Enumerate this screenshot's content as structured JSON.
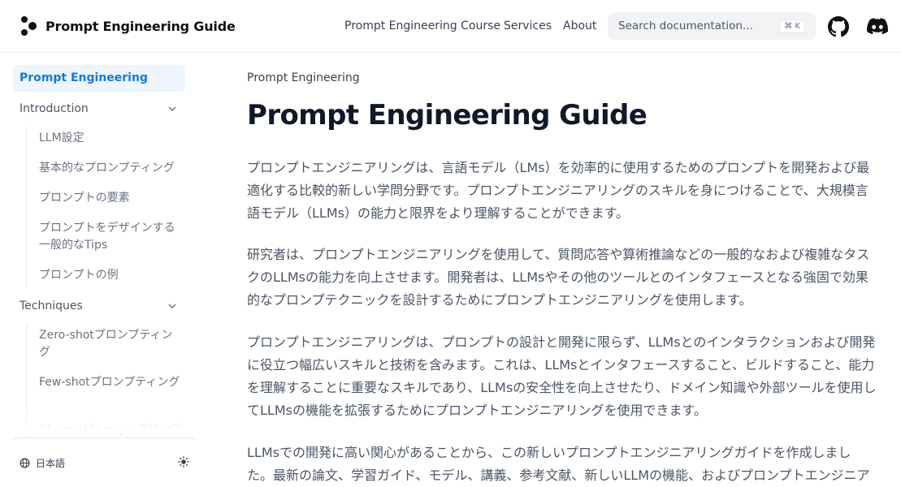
{
  "header": {
    "logo_text": "Prompt Engineering Guide",
    "nav": [
      "Prompt Engineering Course",
      "Services",
      "About"
    ],
    "search_placeholder": "Search documentation...",
    "search_shortcut": "⌘ K",
    "icons": [
      "github-icon",
      "discord-icon"
    ]
  },
  "sidebar": {
    "active_item": "Prompt Engineering",
    "sections": [
      {
        "label": "Introduction",
        "items": [
          "LLM設定",
          "基本的なプロンプティング",
          "プロンプトの要素",
          "プロンプトをデザインする一般的なTips",
          "プロンプトの例"
        ]
      },
      {
        "label": "Techniques",
        "items": [
          "Zero-shotプロンプティング",
          "Few-shotプロンプティング",
          "Chain-of-Thoughtプロンプ"
        ]
      }
    ],
    "footer": {
      "language": "日本語",
      "theme_icon": "sun-icon"
    }
  },
  "main": {
    "breadcrumb": "Prompt Engineering",
    "title": "Prompt Engineering Guide",
    "paragraphs": [
      "プロンプトエンジニアリングは、言語モデル（LMs）を効率的に使用するためのプロンプトを開発および最適化する比較的新しい学問分野です。プロンプトエンジニアリングのスキルを身につけることで、大規模言語モデル（LLMs）の能力と限界をより理解することができます。",
      "研究者は、プロンプトエンジニアリングを使用して、質問応答や算術推論などの一般的なおよび複雑なタスクのLLMsの能力を向上させます。開発者は、LLMsやその他のツールとのインタフェースとなる強固で効果的なプロンプテクニックを設計するためにプロンプトエンジニアリングを使用します。",
      "プロンプトエンジニアリングは、プロンプトの設計と開発に限らず、LLMsとのインタラクションおよび開発に役立つ幅広いスキルと技術を含みます。これは、LLMsとインタフェースすること、ビルドすること、能力を理解することに重要なスキルであり、LLMsの安全性を向上させたり、ドメイン知識や外部ツールを使用してLLMsの機能を拡張するためにプロンプトエンジニアリングを使用できます。",
      "LLMsでの開発に高い関心があることから、この新しいプロンプトエンジニアリングガイドを作成しました。最新の論文、学習ガイド、モデル、講義、参考文献、新しいLLMの機能、およびプロンプトエンジニア"
    ]
  },
  "colors": {
    "accent": "#1778d2",
    "active_bg": "#eef5fd",
    "body_text": "#4b5563",
    "heading": "#111827"
  }
}
